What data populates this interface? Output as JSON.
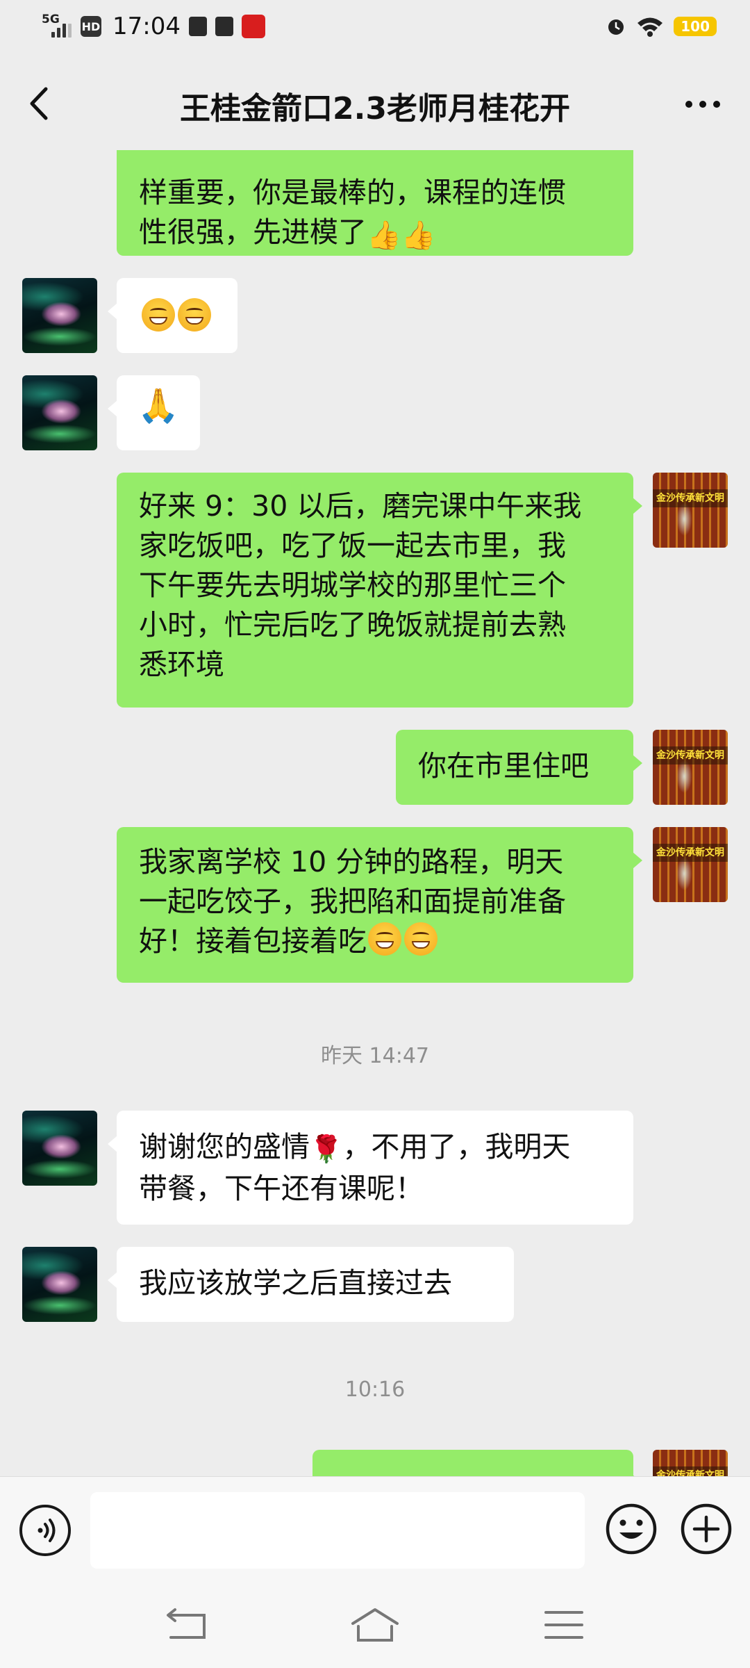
{
  "status_bar": {
    "network": "5G",
    "hd": "HD",
    "time": "17:04",
    "battery": "100"
  },
  "header": {
    "title": "王桂金箭口2.3老师月桂花开"
  },
  "messages": [
    {
      "id": "m1",
      "side": "out",
      "text": "样重要，你是最棒的，课程的连惯",
      "text2": "性很强，先进模了"
    },
    {
      "id": "m2",
      "side": "in",
      "content": "emoji-grin-grin"
    },
    {
      "id": "m3",
      "side": "in",
      "content": "emoji-pray"
    },
    {
      "id": "m4",
      "side": "out",
      "lines": [
        "好来 9：30 以后，磨完课中午来我",
        "家吃饭吧，吃了饭一起去市里，我",
        "下午要先去明城学校的那里忙三个",
        "小时，忙完后吃了晚饭就提前去熟",
        "悉环境"
      ]
    },
    {
      "id": "m5",
      "side": "out",
      "text": "你在市里住吧"
    },
    {
      "id": "m6",
      "side": "out",
      "lines": [
        "我家离学校 10 分钟的路程，明天",
        "一起吃饺子，我把陷和面提前准备"
      ],
      "last_line": "好！接着包接着吃"
    },
    {
      "id": "m7",
      "side": "in",
      "line1a": "谢谢您的盛情",
      "line1b": "，不用了，我明天",
      "line2": "带餐，下午还有课呢！"
    },
    {
      "id": "m8",
      "side": "in",
      "text": "我应该放学之后直接过去"
    }
  ],
  "timestamps": {
    "t1": "昨天 14:47",
    "t2": "10:16"
  },
  "avatar_me_banner": "金沙传承新文明",
  "input": {
    "placeholder": ""
  },
  "icons": {
    "back": "chevron-left-icon",
    "more": "ellipsis-icon",
    "voice": "voice-icon",
    "emoji": "smiley-icon",
    "plus": "plus-icon"
  },
  "colors": {
    "outgoing_bubble": "#95ec69",
    "incoming_bubble": "#ffffff",
    "background": "#ededed",
    "battery": "#f6c500"
  }
}
